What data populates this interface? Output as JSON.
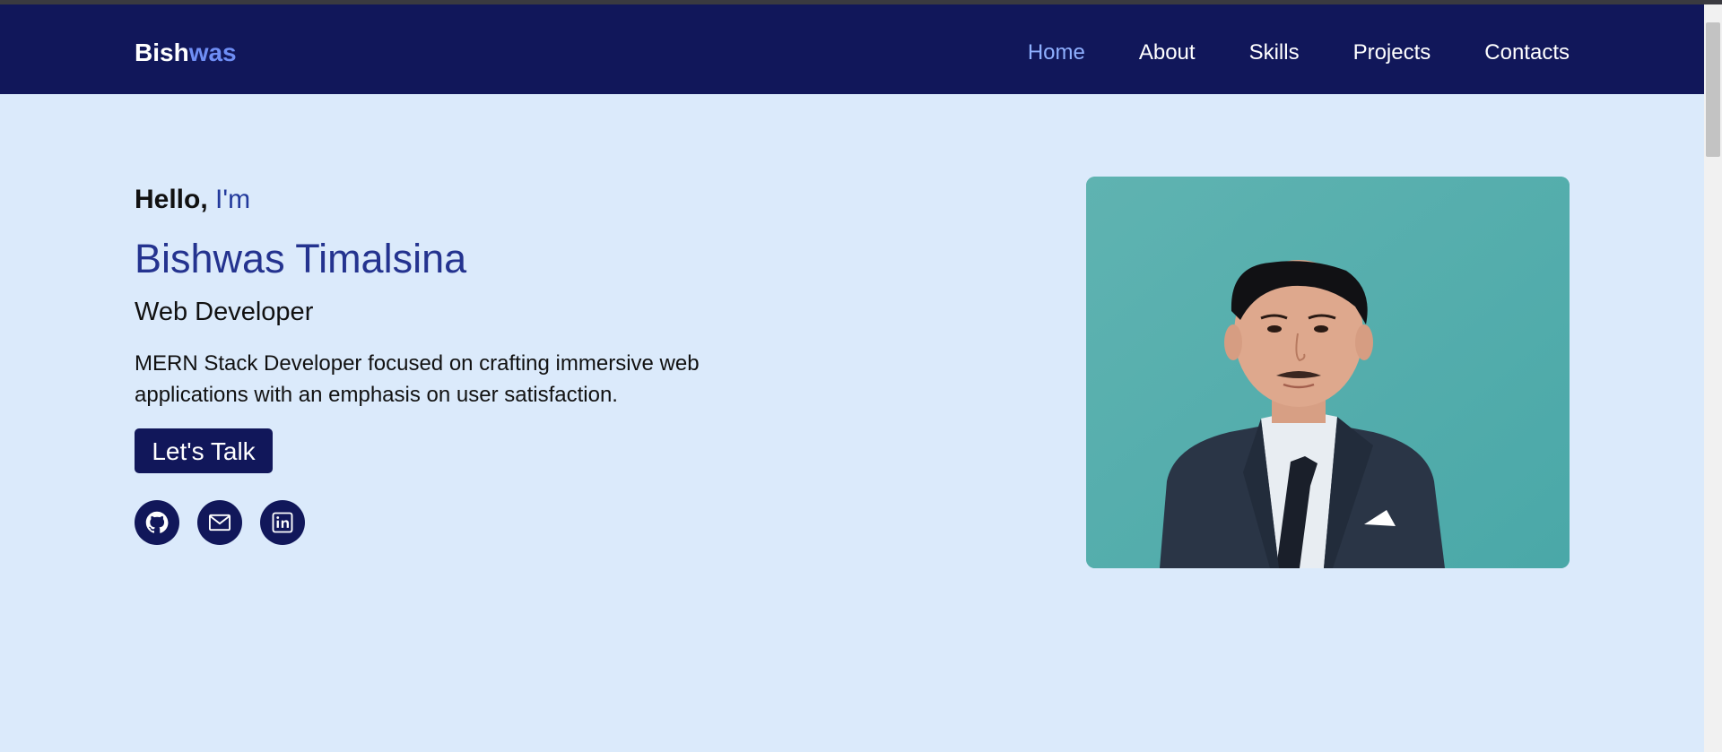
{
  "nav": {
    "brand_first": "Bish",
    "brand_second": "was",
    "links": [
      "Home",
      "About",
      "Skills",
      "Projects",
      "Contacts"
    ],
    "active_link": "Home"
  },
  "hero": {
    "greeting_prefix": "Hello, ",
    "greeting_accent": "I'm",
    "name": "Bishwas Timalsina",
    "role": "Web Developer",
    "description": "MERN Stack Developer focused on crafting immersive web applications with an emphasis on user satisfaction.",
    "cta_label": "Let's Talk",
    "social_icons": [
      "github-icon",
      "mail-icon",
      "linkedin-icon"
    ]
  },
  "colors": {
    "nav_bg": "#11175a",
    "page_bg": "#dbeafb",
    "accent": "#233a9c",
    "active_link": "#8fb0ff",
    "photo_bg": "#5ab4b0"
  }
}
